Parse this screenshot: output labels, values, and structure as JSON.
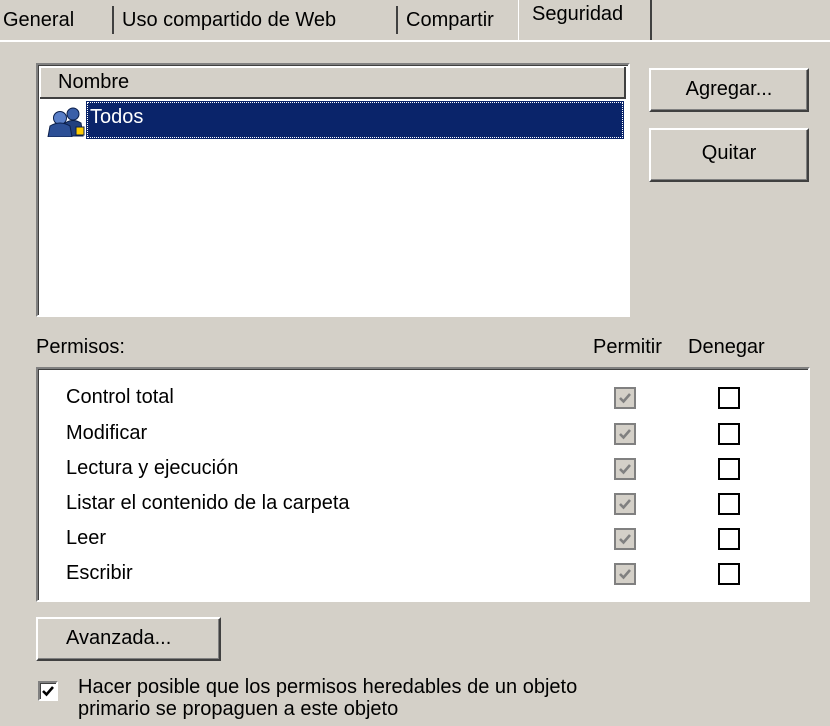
{
  "tabs": [
    {
      "label": "General"
    },
    {
      "label": "Uso compartido de Web"
    },
    {
      "label": "Compartir"
    },
    {
      "label": "Seguridad",
      "active": true
    }
  ],
  "users": {
    "column_header": "Nombre",
    "items": [
      {
        "name": "Todos",
        "selected": true,
        "icon": "group-users-icon"
      }
    ]
  },
  "buttons": {
    "add": "Agregar...",
    "remove": "Quitar",
    "advanced": "Avanzada..."
  },
  "permissions": {
    "label": "Permisos:",
    "allow_header": "Permitir",
    "deny_header": "Denegar",
    "rows": [
      {
        "name": "Control total",
        "allow": true,
        "deny": false
      },
      {
        "name": "Modificar",
        "allow": true,
        "deny": false
      },
      {
        "name": "Lectura y ejecución",
        "allow": true,
        "deny": false
      },
      {
        "name": "Listar el contenido de la carpeta",
        "allow": true,
        "deny": false
      },
      {
        "name": "Leer",
        "allow": true,
        "deny": false
      },
      {
        "name": "Escribir",
        "allow": true,
        "deny": false
      }
    ]
  },
  "inherit": {
    "checked": true,
    "line1": "Hacer posible que los permisos heredables de un objeto",
    "line2": "primario se propaguen a este objeto"
  },
  "colors": {
    "dialog_bg": "#d4d0c8",
    "selection_bg": "#0a246a",
    "selection_text": "#ffffff",
    "disabled_check": "#808080"
  }
}
